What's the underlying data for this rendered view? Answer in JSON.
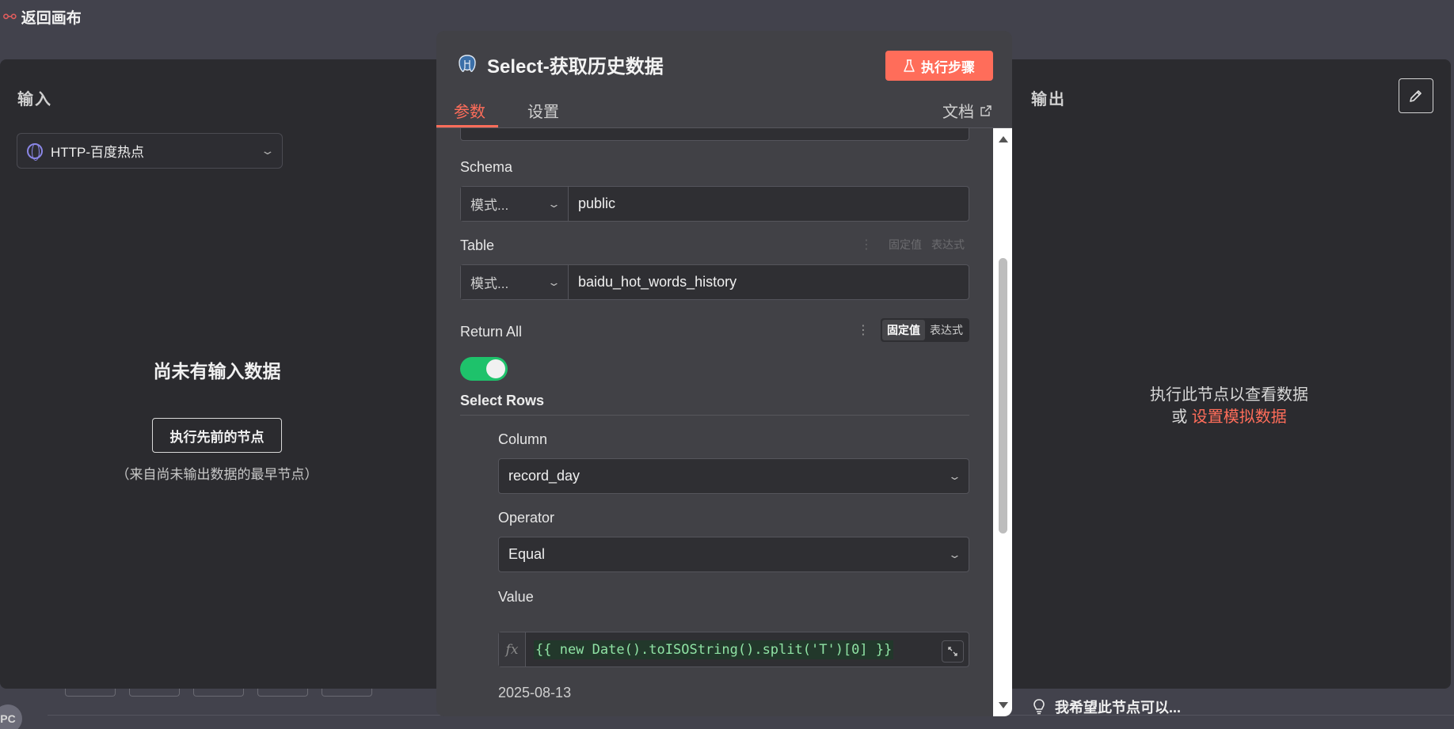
{
  "canvas": {
    "back_label": "返回画布",
    "avatar_initials": "PC"
  },
  "input_panel": {
    "title": "输入",
    "node_select": "HTTP-百度热点",
    "empty_title": "尚未有输入数据",
    "run_previous_label": "执行先前的节点",
    "hint": "（来自尚未输出数据的最早节点）"
  },
  "output_panel": {
    "title": "输出",
    "message_line1": "执行此节点以查看数据",
    "message_or": "或",
    "message_link": "设置模拟数据"
  },
  "wish_prompt": "我希望此节点可以...",
  "modal": {
    "title": "Select-获取历史数据",
    "execute_label": "执行步骤",
    "tabs": [
      {
        "label": "参数",
        "active": true
      },
      {
        "label": "设置",
        "active": false
      }
    ],
    "docs_label": "文档",
    "fields": {
      "schema": {
        "label": "Schema",
        "mode": "模式...",
        "value": "public"
      },
      "table": {
        "label": "Table",
        "mode": "模式...",
        "value": "baidu_hot_words_history"
      },
      "return_all": {
        "label": "Return All",
        "enabled": true
      },
      "select_rows": {
        "label": "Select Rows"
      },
      "column": {
        "label": "Column",
        "value": "record_day"
      },
      "operator": {
        "label": "Operator",
        "value": "Equal"
      },
      "value": {
        "label": "Value",
        "expression": "{{ new Date().toISOString().split('T')[0] }}",
        "result": "2025-08-13"
      }
    },
    "fixed_label": "固定值",
    "expression_label": "表达式"
  },
  "colors": {
    "accent": "#ff6d5a",
    "toggle_on": "#1ec26b",
    "expr_green": "#8fe2a4"
  }
}
